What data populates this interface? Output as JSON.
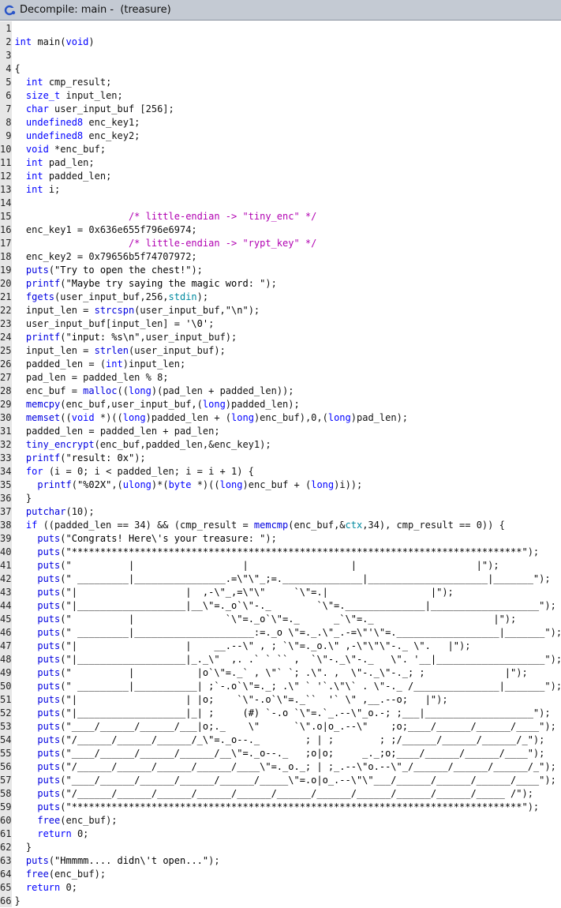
{
  "window": {
    "title": "Decompile: main -  (treasure)",
    "icon": "decompile-icon"
  },
  "colors": {
    "keyword": "#0000ff",
    "comment": "#b100b1",
    "function": "#0000e0",
    "global": "#008aa0",
    "titlebar": "#c4cad3"
  },
  "lines": [
    "",
    "int main(void)",
    "",
    "{",
    "  int cmp_result;",
    "  size_t input_len;",
    "  char user_input_buf [256];",
    "  undefined8 enc_key1;",
    "  undefined8 enc_key2;",
    "  void *enc_buf;",
    "  int pad_len;",
    "  int padded_len;",
    "  int i;",
    "  ",
    "                    /* little-endian -> \"tiny_enc\" */",
    "  enc_key1 = 0x636e655f796e6974;",
    "                    /* little-endian -> \"rypt_key\" */",
    "  enc_key2 = 0x79656b5f74707972;",
    "  puts(\"Try to open the chest!\");",
    "  printf(\"Maybe try saying the magic word: \");",
    "  fgets(user_input_buf,256,stdin);",
    "  input_len = strcspn(user_input_buf,\"\\n\");",
    "  user_input_buf[input_len] = '\\0';",
    "  printf(\"input: %s\\n\",user_input_buf);",
    "  input_len = strlen(user_input_buf);",
    "  padded_len = (int)input_len;",
    "  pad_len = padded_len % 8;",
    "  enc_buf = malloc((long)(pad_len + padded_len));",
    "  memcpy(enc_buf,user_input_buf,(long)padded_len);",
    "  memset((void *)((long)padded_len + (long)enc_buf),0,(long)pad_len);",
    "  padded_len = padded_len + pad_len;",
    "  tiny_encrypt(enc_buf,padded_len,&enc_key1);",
    "  printf(\"result: 0x\");",
    "  for (i = 0; i < padded_len; i = i + 1) {",
    "    printf(\"%02X\",(ulong)*(byte *)((long)enc_buf + (long)i));",
    "  }",
    "  putchar(10);",
    "  if ((padded_len == 34) && (cmp_result = memcmp(enc_buf,&ctx,34), cmp_result == 0)) {",
    "    puts(\"Congrats! Here\\'s your treasure: \");",
    "    puts(\"*******************************************************************************\");",
    "    puts(\"          |                   |                  |                     |\");",
    "    puts(\" _________|________________.=\\\"\\\"_;=.______________|_____________________|_______\");",
    "    puts(\"|                   |  ,-\\\"_,=\\\"\\\"     `\\\"=.|                  |\");",
    "    puts(\"|___________________|__\\\"=._o`\\\"-._        `\\\"=.______________|___________________\");",
    "    puts(\"          |                `\\\"=._o`\\\"=._      _`\\\"=._                     |\");",
    "    puts(\" _________|_____________________:=._o \\\"=._.\\\"_.-=\\\"'\\\"=.__________________|_______\");",
    "    puts(\"|                   |    __.--\\\" , ; `\\\"=._o.\\\" ,-\\\"\\\"\\\"-._ \\\".   |\");",
    "    puts(\"|___________________|_._\\\"  ,. .` ` `` ,  `\\\"-._\\\"-._   \\\". '__|___________________\");",
    "    puts(\"          |           |o`\\\"=._` , \\\"` `; .\\\". ,  \\\"-._\\\"-._; ;              |\");",
    "    puts(\" _________|___________| ;`-.o`\\\"=._; .\\\" ` '`.\\\"\\` . \\\"-._ /_______________|_______\");",
    "    puts(\"|                   | |o;    `\\\"-.o`\\\"=._``  '` \\\" ,__.--o;   |\");",
    "    puts(\"|___________________|_| ;     (#) `-.o `\\\"=.`_.--\\\"_o.-; ;___|___________________\");",
    "    puts(\"____/______/______/___|o;._    \\\"      `\\\".o|o_.--\\\"    ;o;____/______/______/____\");",
    "    puts(\"/______/______/______/_\\\"=._o--._        ; | ;        ; ;/______/______/______/_\");",
    "    puts(\"____/______/______/______/__\\\"=._o--._   ;o|o;     _._;o;____/______/______/____\");",
    "    puts(\"/______/______/______/______/____\\\"=._o._; | ;_.--\\\"o.--\\\"_/______/______/______/_\");",
    "    puts(\"____/______/______/______/______/_____\\\"=.o|o_.--\\\"\\\"___/______/______/______/____\");",
    "    puts(\"/______/______/______/______/______/______/______/______/______/______/_____ /\");",
    "    puts(\"*******************************************************************************\");",
    "    free(enc_buf);",
    "    return 0;",
    "  }",
    "  puts(\"Hmmmm.... didn\\'t open...\");",
    "  free(enc_buf);",
    "  return 0;",
    "}"
  ]
}
